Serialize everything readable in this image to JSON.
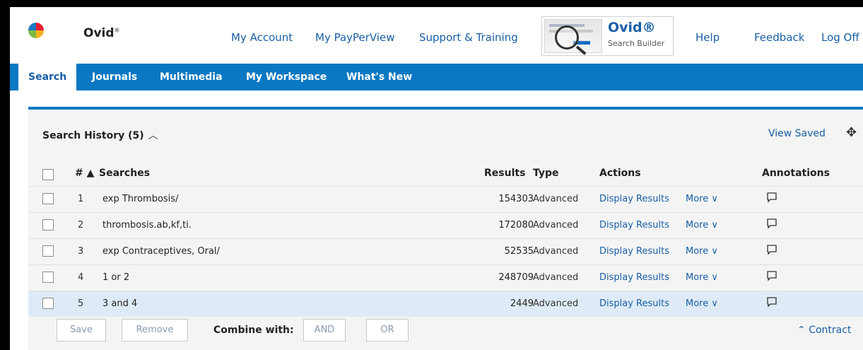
{
  "header": {
    "brand": "Ovid",
    "brand_mark": "®",
    "nav": {
      "my_account": "My Account",
      "my_payperview": "My PayPerView",
      "support_training": "Support & Training",
      "help": "Help",
      "feedback": "Feedback",
      "log_off": "Log Off"
    },
    "search_builder": {
      "title": "Ovid®",
      "subtitle": "Search Builder"
    }
  },
  "tabs": {
    "search": "Search",
    "journals": "Journals",
    "multimedia": "Multimedia",
    "my_workspace": "My Workspace",
    "whats_new": "What's New"
  },
  "history": {
    "title": "Search History (5)",
    "collapse_icon": "chevron-up-icon",
    "view_saved": "View Saved",
    "move_icon": "move-icon",
    "columns": {
      "num": "# ▲",
      "searches": "Searches",
      "results": "Results",
      "type": "Type",
      "actions": "Actions",
      "annotations": "Annotations"
    },
    "rows": [
      {
        "num": "1",
        "search": "exp Thrombosis/",
        "results": "154303",
        "type": "Advanced",
        "display": "Display Results",
        "more": "More ∨"
      },
      {
        "num": "2",
        "search": "thrombosis.ab,kf,ti.",
        "results": "172080",
        "type": "Advanced",
        "display": "Display Results",
        "more": "More ∨"
      },
      {
        "num": "3",
        "search": "exp Contraceptives, Oral/",
        "results": "52535",
        "type": "Advanced",
        "display": "Display Results",
        "more": "More ∨"
      },
      {
        "num": "4",
        "search": "1 or 2",
        "results": "248709",
        "type": "Advanced",
        "display": "Display Results",
        "more": "More ∨"
      },
      {
        "num": "5",
        "search": "3 and 4",
        "results": "2449",
        "type": "Advanced",
        "display": "Display Results",
        "more": "More ∨"
      }
    ],
    "selected_row": "5",
    "buttons": {
      "save": "Save",
      "remove": "Remove",
      "combine_with": "Combine with:",
      "and": "AND",
      "or": "OR",
      "contract": "Contract",
      "contract_icon": "double-chevron-up-icon"
    }
  },
  "colors": {
    "accent": "#0a78c2",
    "link": "#1a5fa6",
    "selected_row": "#deebf6"
  }
}
